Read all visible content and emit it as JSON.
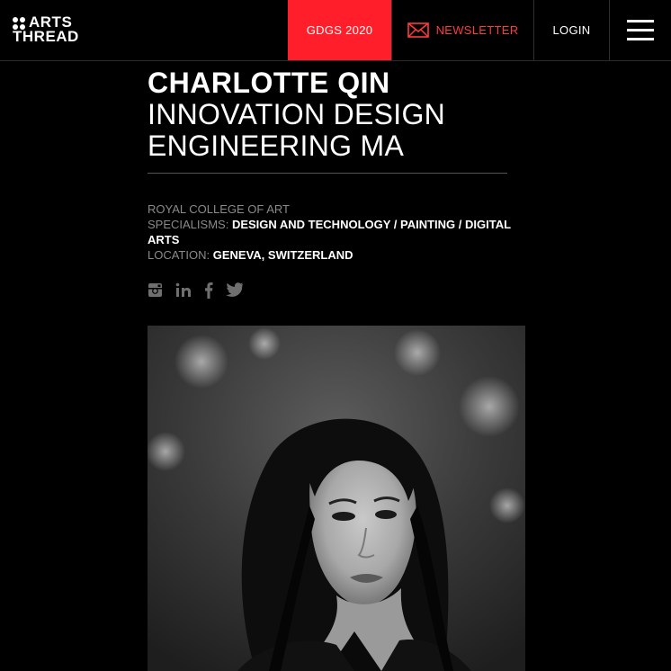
{
  "header": {
    "logo_line1": "ARTS",
    "logo_line2": "THREAD",
    "nav_gdgs": "GDGS 2020",
    "nav_newsletter": "NEWSLETTER",
    "nav_login": "LOGIN",
    "accent_color": "#ff1e2a"
  },
  "profile": {
    "name": "CHARLOTTE QIN",
    "course_line1": "INNOVATION DESIGN",
    "course_line2": "ENGINEERING MA",
    "school": "ROYAL COLLEGE OF ART",
    "specialisms_label": "SPECIALISMS:",
    "specialisms_value": "DESIGN AND TECHNOLOGY / PAINTING / DIGITAL ARTS",
    "location_label": "LOCATION:",
    "location_value": "GENEVA, SWITZERLAND"
  },
  "social_icons": [
    "instagram-icon",
    "linkedin-icon",
    "facebook-icon",
    "twitter-icon"
  ]
}
